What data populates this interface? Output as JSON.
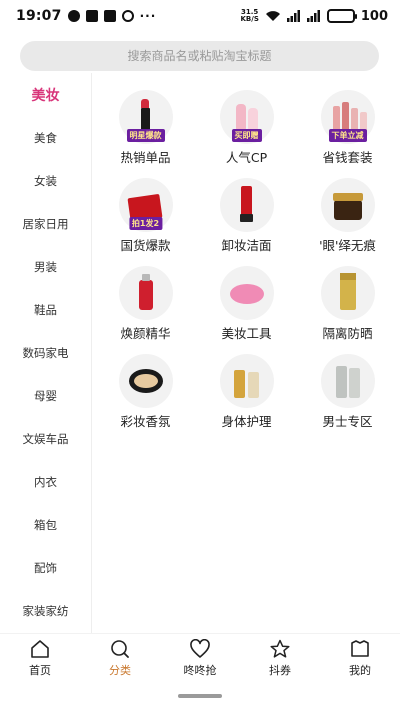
{
  "status_bar": {
    "time": "19:07",
    "more": "···",
    "speed_top": "31.5",
    "speed_bottom": "KB/S",
    "battery_level": "100"
  },
  "search": {
    "placeholder": "搜索商品名或粘贴淘宝标题"
  },
  "sidebar": {
    "items": [
      {
        "label": "美妆"
      },
      {
        "label": "美食"
      },
      {
        "label": "女装"
      },
      {
        "label": "居家日用"
      },
      {
        "label": "男装"
      },
      {
        "label": "鞋品"
      },
      {
        "label": "数码家电"
      },
      {
        "label": "母婴"
      },
      {
        "label": "文娱车品"
      },
      {
        "label": "内衣"
      },
      {
        "label": "箱包"
      },
      {
        "label": "配饰"
      },
      {
        "label": "家装家纺"
      }
    ]
  },
  "categories": [
    {
      "label": "热销单品",
      "badge": "明星爆款",
      "icon": "lipstick-icon"
    },
    {
      "label": "人气CP",
      "badge": "买即赠",
      "icon": "cp-bottles-icon"
    },
    {
      "label": "省钱套装",
      "badge": "下单立减",
      "icon": "skincare-set-icon"
    },
    {
      "label": "国货爆款",
      "badge": "拍1发2",
      "icon": "gift-box-icon"
    },
    {
      "label": "卸妆洁面",
      "badge": "",
      "icon": "cleanser-tube-icon"
    },
    {
      "label": "'眼'绎无痕",
      "badge": "",
      "icon": "eye-cream-jar-icon"
    },
    {
      "label": "焕颜精华",
      "badge": "",
      "icon": "serum-bottle-icon"
    },
    {
      "label": "美妆工具",
      "badge": "",
      "icon": "cleansing-brush-icon"
    },
    {
      "label": "隔离防晒",
      "badge": "",
      "icon": "sunscreen-icon"
    },
    {
      "label": "彩妆香氛",
      "badge": "",
      "icon": "cushion-compact-icon"
    },
    {
      "label": "身体护理",
      "badge": "",
      "icon": "body-care-icon"
    },
    {
      "label": "男士专区",
      "badge": "",
      "icon": "mens-bottles-icon"
    }
  ],
  "bottom_nav": {
    "items": [
      {
        "label": "首页",
        "icon": "home-icon"
      },
      {
        "label": "分类",
        "icon": "category-search-icon"
      },
      {
        "label": "咚咚抢",
        "icon": "heart-icon"
      },
      {
        "label": "抖券",
        "icon": "star-icon"
      },
      {
        "label": "我的",
        "icon": "profile-icon"
      }
    ]
  },
  "colors": {
    "accent_pink": "#d8357a",
    "active_nav": "#c9782e",
    "badge_bg": "#6b1fa0",
    "badge_text": "#ffe58a"
  }
}
